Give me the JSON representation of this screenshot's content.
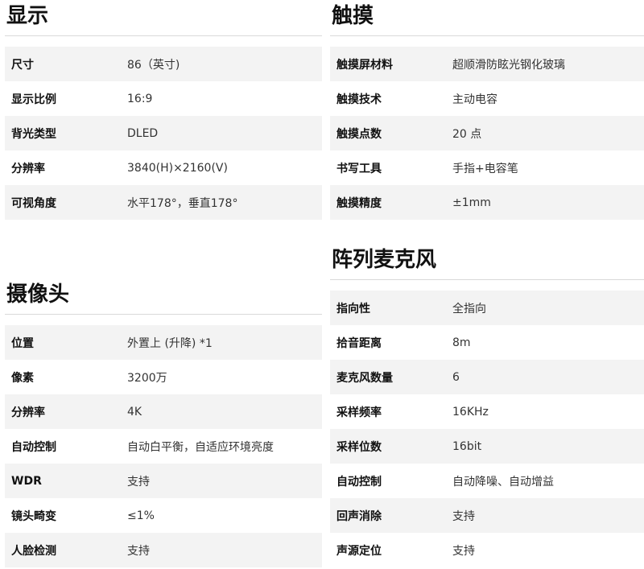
{
  "display": {
    "title": "显示",
    "rows": [
      {
        "label": "尺寸",
        "value": "86（英寸)"
      },
      {
        "label": "显示比例",
        "value": "16:9"
      },
      {
        "label": "背光类型",
        "value": "DLED"
      },
      {
        "label": "分辨率",
        "value": "3840(H)×2160(V)"
      },
      {
        "label": "可视角度",
        "value": "水平178°，垂直178°"
      }
    ]
  },
  "touch": {
    "title": "触摸",
    "rows": [
      {
        "label": "触摸屏材料",
        "value": "超顺滑防眩光钢化玻璃"
      },
      {
        "label": "触摸技术",
        "value": "主动电容"
      },
      {
        "label": "触摸点数",
        "value": "20 点"
      },
      {
        "label": "书写工具",
        "value": "手指+电容笔"
      },
      {
        "label": "触摸精度",
        "value": "±1mm"
      }
    ]
  },
  "camera": {
    "title": "摄像头",
    "rows": [
      {
        "label": "位置",
        "value": "外置上 (升降) *1"
      },
      {
        "label": "像素",
        "value": "3200万"
      },
      {
        "label": "分辨率",
        "value": "4K"
      },
      {
        "label": "自动控制",
        "value": "自动白平衡，自适应环境亮度"
      },
      {
        "label": "WDR",
        "value": "支持"
      },
      {
        "label": "镜头畸变",
        "value": "≤1%"
      },
      {
        "label": "人脸检测",
        "value": "支持"
      }
    ]
  },
  "mic": {
    "title": "阵列麦克风",
    "rows": [
      {
        "label": "指向性",
        "value": "全指向"
      },
      {
        "label": "拾音距离",
        "value": "8m"
      },
      {
        "label": "麦克风数量",
        "value": "6"
      },
      {
        "label": "采样频率",
        "value": "16KHz"
      },
      {
        "label": "采样位数",
        "value": "16bit"
      },
      {
        "label": "自动控制",
        "value": "自动降噪、自动增益"
      },
      {
        "label": "回声消除",
        "value": "支持"
      },
      {
        "label": "声源定位",
        "value": "支持"
      }
    ]
  }
}
